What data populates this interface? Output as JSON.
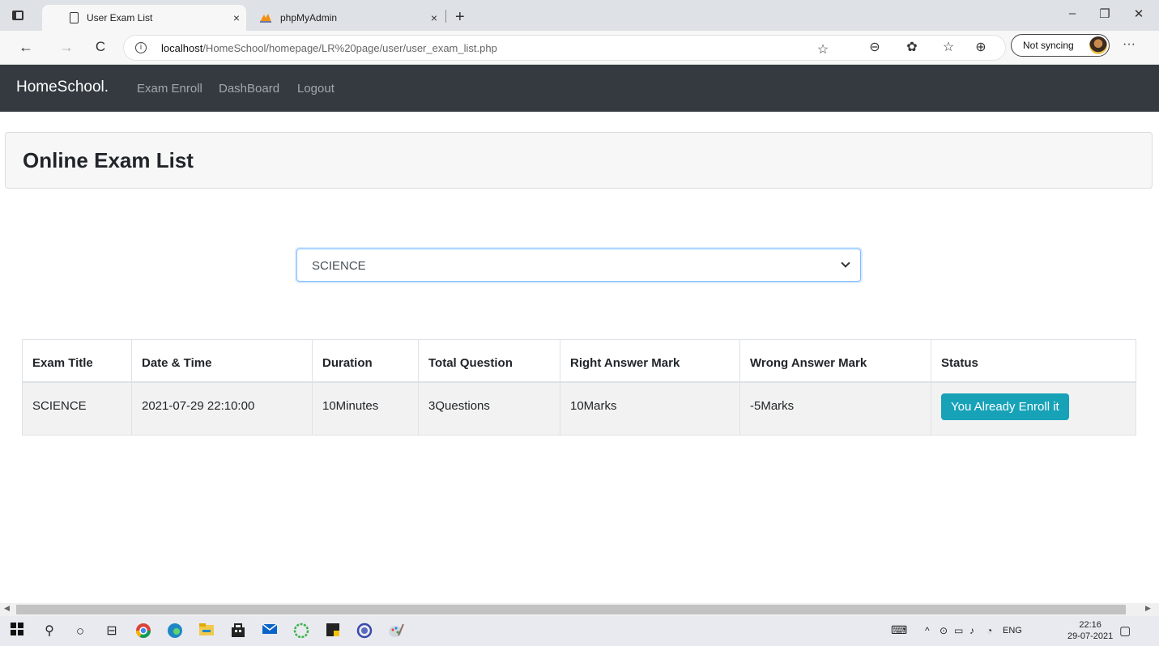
{
  "browser": {
    "tabs": [
      {
        "title": "User Exam List",
        "close": "×"
      },
      {
        "title": "phpMyAdmin",
        "close": "×"
      }
    ],
    "new_tab": "+",
    "window_controls": {
      "minimize": "–",
      "restore": "❐",
      "close": "✕"
    },
    "nav": {
      "back": "←",
      "forward": "→",
      "refresh": "C"
    },
    "url_host": "localhost",
    "url_path": "/HomeSchool/homepage/LR%20page/user/user_exam_list.php",
    "sync_label": "Not syncing",
    "more": "···"
  },
  "site": {
    "brand": "HomeSchool.",
    "nav": [
      {
        "label": "Exam Enroll"
      },
      {
        "label": "DashBoard"
      },
      {
        "label": "Logout"
      }
    ]
  },
  "card": {
    "title": "Online Exam List"
  },
  "exam_select": {
    "value": "SCIENCE"
  },
  "table": {
    "headers": [
      "Exam Title",
      "Date & Time",
      "Duration",
      "Total Question",
      "Right Answer Mark",
      "Wrong Answer Mark",
      "Status"
    ],
    "rows": [
      {
        "title": "SCIENCE",
        "datetime": "2021-07-29 22:10:00",
        "duration": "10Minutes",
        "questions": "3Questions",
        "right": "10Marks",
        "wrong": "-5Marks",
        "status_button": "You Already Enroll it"
      }
    ]
  },
  "taskbar": {
    "lang": "ENG",
    "time": "22:16",
    "date": "29-07-2021"
  }
}
